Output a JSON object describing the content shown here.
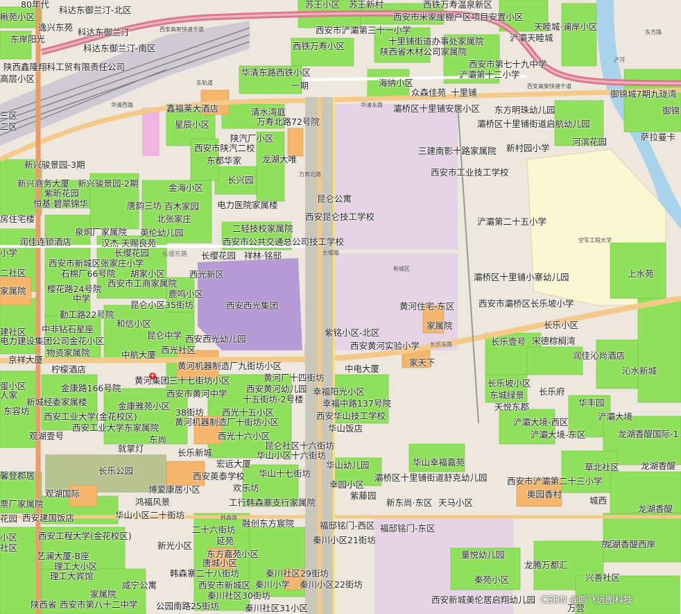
{
  "map": {
    "colors": {
      "background": "#eee8df",
      "green_area": "#8fe05a",
      "residential_orange": "#f5b56a",
      "institution_pink": "#e6d3e6",
      "purple_block": "#b59ad6",
      "highway_pink": "#d97a8d",
      "main_road_orange": "#f5c98a",
      "river_blue": "#a8d3ea",
      "campus_yellow": "#fbf7d2"
    },
    "labels": [
      {
        "id": "l1",
        "text": "80年代"
      },
      {
        "id": "l2",
        "text": "苏王小区"
      },
      {
        "id": "l3",
        "text": "苏王新村"
      },
      {
        "id": "l4",
        "text": "西铁万寿温泉新区"
      },
      {
        "id": "l5",
        "text": "楸苑小区"
      },
      {
        "id": "l6",
        "text": "科达东御兰汀-北区"
      },
      {
        "id": "l7",
        "text": "西安市米家崖棚户区项目安置小区"
      },
      {
        "id": "l8",
        "text": "天睦城·澜岸小区"
      },
      {
        "id": "l9",
        "text": "逸兴东苑"
      },
      {
        "id": "l10",
        "text": "科达东御兰汀"
      },
      {
        "id": "l11",
        "text": "西安市浐灞第三十一小学"
      },
      {
        "id": "l12",
        "text": "十里铺街道办事处家属院"
      },
      {
        "id": "l13",
        "text": "浐灞天睦城"
      },
      {
        "id": "l14",
        "text": "东岸阳光"
      },
      {
        "id": "l15",
        "text": "科达东御兰汀-南区"
      },
      {
        "id": "l16",
        "text": "西铁万寿小区"
      },
      {
        "id": "l17",
        "text": "陕西省木材公司家属院"
      },
      {
        "id": "l18",
        "text": "陕西鑫隆翔科工贸有限责任公司"
      },
      {
        "id": "l19",
        "text": "西安市第七十九中学"
      },
      {
        "id": "l20",
        "text": "浐灞第十二小学"
      },
      {
        "id": "l21",
        "text": "高层小区"
      },
      {
        "id": "l22",
        "text": "华清东路西铁小区"
      },
      {
        "id": "l23",
        "text": "一期"
      },
      {
        "id": "l24",
        "text": "海纳小区"
      },
      {
        "id": "l25",
        "text": "众森佳苑"
      },
      {
        "id": "l26",
        "text": "十里铺"
      },
      {
        "id": "l27",
        "text": "御锦城7期九珑湾"
      },
      {
        "id": "l28",
        "text": "鑫福莱大酒店"
      },
      {
        "id": "l29",
        "text": "清水湾庭"
      },
      {
        "id": "l30",
        "text": "灞桥区十里铺安居小区"
      },
      {
        "id": "l31",
        "text": "东方明珠幼儿园"
      },
      {
        "id": "l32",
        "text": "御锦"
      },
      {
        "id": "l33",
        "text": "三区"
      },
      {
        "id": "l34",
        "text": "万寿北路72号院"
      },
      {
        "id": "l35",
        "text": "灞桥区十里铺街道启航幼儿园"
      },
      {
        "id": "l36",
        "text": "萨拉曼卡"
      },
      {
        "id": "l37",
        "text": "二区"
      },
      {
        "id": "l38",
        "text": "星辰小区"
      },
      {
        "id": "l39",
        "text": "陕汽厂小区"
      },
      {
        "id": "l40",
        "text": "河滨花园"
      },
      {
        "id": "l41",
        "text": "西安市陕汽二校"
      },
      {
        "id": "l42",
        "text": "新村园小学"
      },
      {
        "id": "l43",
        "text": "三建南影十路家属院"
      },
      {
        "id": "l44",
        "text": "东都华家"
      },
      {
        "id": "l45",
        "text": "龙湖大唯"
      },
      {
        "id": "l46",
        "text": "新兴骏景园-3期"
      },
      {
        "id": "l47",
        "text": "西安市工业技工学校"
      },
      {
        "id": "l48",
        "text": "长兴园"
      },
      {
        "id": "l49",
        "text": "新兴商务大厦"
      },
      {
        "id": "l50",
        "text": "新兴骏景园-2期"
      },
      {
        "id": "l51",
        "text": "金海小区"
      },
      {
        "id": "l52",
        "text": "紫昕花园"
      },
      {
        "id": "l53",
        "text": "昆仑公寓"
      },
      {
        "id": "l54",
        "text": "恒基·碧翠锦华"
      },
      {
        "id": "l55",
        "text": "唐韵三坊"
      },
      {
        "id": "l56",
        "text": "百木家园"
      },
      {
        "id": "l57",
        "text": "电力医院家属楼"
      },
      {
        "id": "l58",
        "text": "房住宅楼"
      },
      {
        "id": "l59",
        "text": "北张家庄"
      },
      {
        "id": "l60",
        "text": "西安昆仑技工学校"
      },
      {
        "id": "l61",
        "text": "浐灞第二十五小学"
      },
      {
        "id": "l62",
        "text": "泉炯厂家属院"
      },
      {
        "id": "l63",
        "text": "英伦幼儿园"
      },
      {
        "id": "l64",
        "text": "二轻技校家属院"
      },
      {
        "id": "l65",
        "text": "润佳连锁酒店"
      },
      {
        "id": "l66",
        "text": "汉杰·天赐良苑"
      },
      {
        "id": "l67",
        "text": "西安市公共交通总公司技工学校"
      },
      {
        "id": "l68",
        "text": "小学"
      },
      {
        "id": "l69",
        "text": "长缨东路"
      },
      {
        "id": "l70",
        "text": "长缨花园"
      },
      {
        "id": "l71",
        "text": "祥林·铭邸"
      },
      {
        "id": "l72",
        "text": "西安市新城区张家庄小学"
      },
      {
        "id": "l73",
        "text": "上水苑"
      },
      {
        "id": "l74",
        "text": "二社区"
      },
      {
        "id": "l75",
        "text": "石棉厂66号院"
      },
      {
        "id": "l76",
        "text": "胡家小区"
      },
      {
        "id": "l77",
        "text": "西光新区"
      },
      {
        "id": "l78",
        "text": "灞桥区十里铺小寨幼儿园"
      },
      {
        "id": "l79",
        "text": "家属院"
      },
      {
        "id": "l80",
        "text": "西安市工商家属院"
      },
      {
        "id": "l81",
        "text": "樱花路24号院"
      },
      {
        "id": "l82",
        "text": "鹿鸣小区"
      },
      {
        "id": "l83",
        "text": "西安市灞桥区长乐坡小学"
      },
      {
        "id": "l84",
        "text": "中学"
      },
      {
        "id": "l85",
        "text": "昆仑小区35街坊"
      },
      {
        "id": "l86",
        "text": "西安西光集团"
      },
      {
        "id": "l87",
        "text": "黄河住宅-东区"
      },
      {
        "id": "l88",
        "text": "勤工路22号院"
      },
      {
        "id": "l89",
        "text": "和信小区"
      },
      {
        "id": "l90",
        "text": "家属院"
      },
      {
        "id": "l91",
        "text": "长乐小区"
      },
      {
        "id": "l92",
        "text": "中非钻石星座"
      },
      {
        "id": "l93",
        "text": "建社区"
      },
      {
        "id": "l94",
        "text": "紫铭小区-北区"
      },
      {
        "id": "l95",
        "text": "昆仑中学"
      },
      {
        "id": "l96",
        "text": "电力建设集团公司金花小区"
      },
      {
        "id": "l97",
        "text": "西安西光幼儿园"
      },
      {
        "id": "l98",
        "text": "西安黄河实验小学"
      },
      {
        "id": "l99",
        "text": "长乐壹号"
      },
      {
        "id": "l100",
        "text": "宋德棕榈湾"
      },
      {
        "id": "l101",
        "text": "西光社区"
      },
      {
        "id": "l102",
        "text": "物资家属院"
      },
      {
        "id": "l103",
        "text": "中航大厦"
      },
      {
        "id": "l104",
        "text": "润佳沁尚酒店"
      },
      {
        "id": "l105",
        "text": "京祥大厦"
      },
      {
        "id": "l106",
        "text": "家天下"
      },
      {
        "id": "l107",
        "text": "黄河机器制造厂九街坊小区"
      },
      {
        "id": "l108",
        "text": "中电大厦"
      },
      {
        "id": "l109",
        "text": "柠檬酒店"
      },
      {
        "id": "l110",
        "text": "沁水新城"
      },
      {
        "id": "l111",
        "text": "黄河厂十四街坊"
      },
      {
        "id": "l112",
        "text": "黄河集团三十七街坊小区"
      },
      {
        "id": "l113",
        "text": "长乐坡小区"
      },
      {
        "id": "l114",
        "text": "幸福阳光小区"
      },
      {
        "id": "l115",
        "text": "西安黄河幼儿园"
      },
      {
        "id": "l116",
        "text": "金康路166号院"
      },
      {
        "id": "l117",
        "text": "长乐府"
      },
      {
        "id": "l118",
        "text": "东城绿景"
      },
      {
        "id": "l119",
        "text": "西安市黄河中学"
      },
      {
        "id": "l120",
        "text": "十五街坊-2号楼"
      },
      {
        "id": "l121",
        "text": "蛋小区"
      },
      {
        "id": "l122",
        "text": "人家"
      },
      {
        "id": "l123",
        "text": "新城经委家属楼"
      },
      {
        "id": "l124",
        "text": "幸福中路137号院"
      },
      {
        "id": "l125",
        "text": "天悦东郡"
      },
      {
        "id": "l126",
        "text": "华丰园"
      },
      {
        "id": "l127",
        "text": "金康雅苑小区"
      },
      {
        "id": "l128",
        "text": "东容坊"
      },
      {
        "id": "l129",
        "text": "西安工业大学(金花校区)"
      },
      {
        "id": "l130",
        "text": "38街坊"
      },
      {
        "id": "l131",
        "text": "西光十五小区"
      },
      {
        "id": "l132",
        "text": "西安华山技工学校"
      },
      {
        "id": "l133",
        "text": "浐灞大境"
      },
      {
        "id": "l134",
        "text": "浐灞大境-西区"
      },
      {
        "id": "l135",
        "text": "西安工业大学东家属院"
      },
      {
        "id": "l136",
        "text": "黄河机器制造厂十街坊小区"
      },
      {
        "id": "l137",
        "text": "华山饭店"
      },
      {
        "id": "l138",
        "text": "观湖壹号"
      },
      {
        "id": "l139",
        "text": "东尚"
      },
      {
        "id": "l140",
        "text": "西光十六小区"
      },
      {
        "id": "l141",
        "text": "昆仑社区十六街坊"
      },
      {
        "id": "l142",
        "text": "浐灞大境-东区"
      },
      {
        "id": "l143",
        "text": "龙湖香醍国际-1"
      },
      {
        "id": "l144",
        "text": "就掌灯"
      },
      {
        "id": "l145",
        "text": "长乐新城"
      },
      {
        "id": "l146",
        "text": "华山小区十六街坊"
      },
      {
        "id": "l147",
        "text": "华山幸福嘉苑"
      },
      {
        "id": "l148",
        "text": "宏远大厦"
      },
      {
        "id": "l149",
        "text": "华山幼儿园"
      },
      {
        "id": "l150",
        "text": "草北社区"
      },
      {
        "id": "l151",
        "text": "龙湖香醍"
      },
      {
        "id": "l152",
        "text": "长乐公园"
      },
      {
        "id": "l153",
        "text": "馨登郡居"
      },
      {
        "id": "l154",
        "text": "西安英泰学校"
      },
      {
        "id": "l155",
        "text": "华山十七街坊"
      },
      {
        "id": "l156",
        "text": "灞桥区十里铺街道舒克幼儿园"
      },
      {
        "id": "l157",
        "text": "幸园小区"
      },
      {
        "id": "l158",
        "text": "西安市浐灞第二十三小学"
      },
      {
        "id": "l159",
        "text": "博爱康居小区"
      },
      {
        "id": "l160",
        "text": "欢乐坊"
      },
      {
        "id": "l161",
        "text": "奥园香村"
      },
      {
        "id": "l162",
        "text": "紫藤园"
      },
      {
        "id": "l163",
        "text": "观湖国际"
      },
      {
        "id": "l164",
        "text": "新东尚·东区"
      },
      {
        "id": "l165",
        "text": "天马小区"
      },
      {
        "id": "l166",
        "text": "城西"
      },
      {
        "id": "l167",
        "text": "鸿福风景"
      },
      {
        "id": "l168",
        "text": "工行韩森寨支行家属院"
      },
      {
        "id": "l169",
        "text": "龙湖香醍"
      },
      {
        "id": "l170",
        "text": "票厂家属院"
      },
      {
        "id": "l171",
        "text": "华山小区二十街坊"
      },
      {
        "id": "l172",
        "text": "花园"
      },
      {
        "id": "l173",
        "text": "西安建国饭店"
      },
      {
        "id": "l174",
        "text": "融创东方宸院"
      },
      {
        "id": "l175",
        "text": "福邸铭门-西区"
      },
      {
        "id": "l176",
        "text": "福邸铭门-东区"
      },
      {
        "id": "l177",
        "text": "二十六街坊"
      },
      {
        "id": "l178",
        "text": "小区"
      },
      {
        "id": "l179",
        "text": "西安工程大学(金花校区)"
      },
      {
        "id": "l180",
        "text": "延苑"
      },
      {
        "id": "l181",
        "text": "秦川小区21街坊"
      },
      {
        "id": "l182",
        "text": "东区"
      },
      {
        "id": "l183",
        "text": "龙湖香醍西岸"
      },
      {
        "id": "l184",
        "text": "新光小区"
      },
      {
        "id": "l185",
        "text": "社区"
      },
      {
        "id": "l186",
        "text": "艺澜大厦-B座"
      },
      {
        "id": "l187",
        "text": "东方嘉苑小区"
      },
      {
        "id": "l188",
        "text": "童悦幼儿园"
      },
      {
        "id": "l189",
        "text": "理工大小区"
      },
      {
        "id": "l190",
        "text": "唐城小区"
      },
      {
        "id": "l191",
        "text": "龙腾万都汇"
      },
      {
        "id": "l192",
        "text": "理工大宾馆"
      },
      {
        "id": "l193",
        "text": "韩森寨二十八街坊"
      },
      {
        "id": "l194",
        "text": "秦川社区29街坊"
      },
      {
        "id": "l195",
        "text": "兴善社区"
      },
      {
        "id": "l196",
        "text": "咸宁公寓"
      },
      {
        "id": "l197",
        "text": "西安市新城区"
      },
      {
        "id": "l198",
        "text": "秦川小学"
      },
      {
        "id": "l199",
        "text": "秦川小区22街坊"
      },
      {
        "id": "l200",
        "text": "秦苑小区"
      },
      {
        "id": "l201",
        "text": "家属院"
      },
      {
        "id": "l202",
        "text": "秦川社区30街坊"
      },
      {
        "id": "l203",
        "text": "陕西省"
      },
      {
        "id": "l204",
        "text": "西安市第八十二中学"
      },
      {
        "id": "l205",
        "text": "公园南路25街坊"
      },
      {
        "id": "l206",
        "text": "秦川社区31小区"
      },
      {
        "id": "l207",
        "text": "西安新城美伦居启翔幼儿园"
      },
      {
        "id": "l208",
        "text": "万营"
      }
    ],
    "small_labels": [
      {
        "id": "s1",
        "text": "西安高架快速干道"
      },
      {
        "id": "s2",
        "text": "华清东路"
      },
      {
        "id": "s3",
        "text": "华清西路"
      },
      {
        "id": "s4",
        "text": "东轨道"
      },
      {
        "id": "s5",
        "text": "万寿北路"
      },
      {
        "id": "s6",
        "text": "长乐东路"
      },
      {
        "id": "s7",
        "text": "长缨路"
      },
      {
        "id": "s8",
        "text": "韩森路"
      },
      {
        "id": "s9",
        "text": "空军工程大学"
      },
      {
        "id": "s10",
        "text": "新城区"
      },
      {
        "id": "s11",
        "text": "东方路"
      },
      {
        "id": "s12",
        "text": "浐河"
      }
    ],
    "watermark": "CSDN @鸣飞远图科技"
  }
}
